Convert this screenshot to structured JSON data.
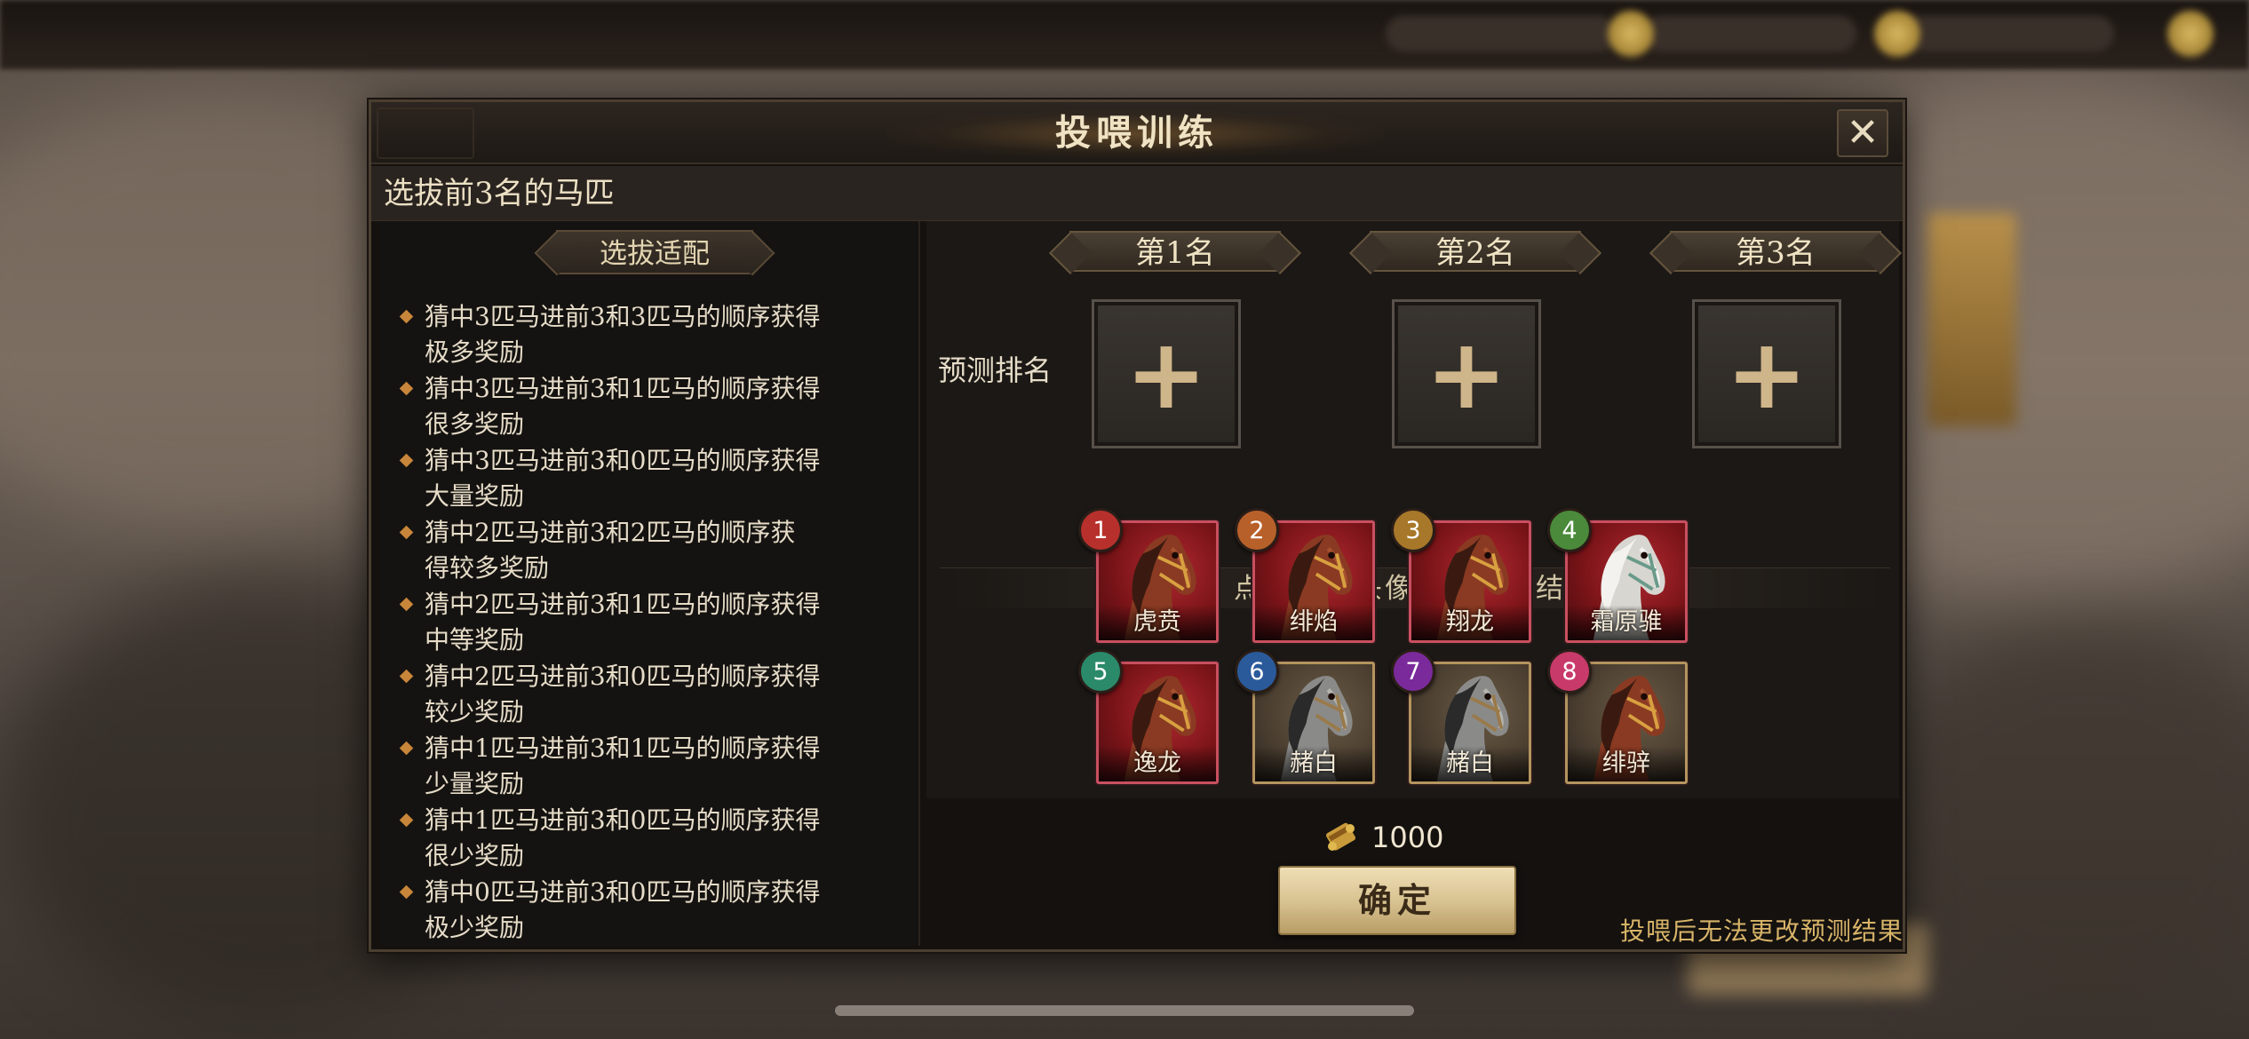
{
  "dialog": {
    "title": "投喂训练",
    "close_symbol": "✕",
    "subtitle": "选拔前3名的马匹"
  },
  "rules": {
    "header": "选拔适配",
    "items": [
      [
        "猜中3匹马进前3和3匹马的顺序获得",
        "极多奖励"
      ],
      [
        "猜中3匹马进前3和1匹马的顺序获得",
        "很多奖励"
      ],
      [
        "猜中3匹马进前3和0匹马的顺序获得",
        "大量奖励"
      ],
      [
        "猜中2匹马进前3和2匹马的顺序获",
        "得较多奖励"
      ],
      [
        "猜中2匹马进前3和1匹马的顺序获得",
        "中等奖励"
      ],
      [
        "猜中2匹马进前3和0匹马的顺序获得",
        "较少奖励"
      ],
      [
        "猜中1匹马进前3和1匹马的顺序获得",
        "少量奖励"
      ],
      [
        "猜中1匹马进前3和0匹马的顺序获得",
        "很少奖励"
      ],
      [
        "猜中0匹马进前3和0匹马的顺序获得",
        "极少奖励"
      ]
    ]
  },
  "prediction": {
    "label": "预测排名",
    "ranks": [
      "第1名",
      "第2名",
      "第3名"
    ],
    "slot_symbol": "+",
    "hint": "点击马匹头像预测选拔结果"
  },
  "horses": [
    {
      "number": "1",
      "name": "虎贲",
      "frame": "red",
      "coat": "chestnut",
      "badge_color": "#b8302c"
    },
    {
      "number": "2",
      "name": "绯焰",
      "frame": "red",
      "coat": "chestnut",
      "badge_color": "#b8602a"
    },
    {
      "number": "3",
      "name": "翔龙",
      "frame": "red",
      "coat": "chestnut",
      "badge_color": "#a8782a"
    },
    {
      "number": "4",
      "name": "霜原骓",
      "frame": "red",
      "coat": "white",
      "badge_color": "#4a8a3a"
    },
    {
      "number": "5",
      "name": "逸龙",
      "frame": "red",
      "coat": "chestnut",
      "badge_color": "#2a8a6a"
    },
    {
      "number": "6",
      "name": "赭白",
      "frame": "gold",
      "coat": "grey",
      "badge_color": "#2a5a9a"
    },
    {
      "number": "7",
      "name": "赭白",
      "frame": "gold",
      "coat": "grey",
      "badge_color": "#7a2a9a"
    },
    {
      "number": "8",
      "name": "绯骍",
      "frame": "gold",
      "coat": "chestnut",
      "badge_color": "#c83a6a"
    }
  ],
  "cost": {
    "icon": "scroll-icon",
    "value": "1000"
  },
  "confirm_label": "确定",
  "footer_note": "投喂后无法更改预测结果",
  "colors": {
    "accent_gold": "#d8b468",
    "panel_bg": "#14110f",
    "button_gold": "#d6c08e"
  }
}
